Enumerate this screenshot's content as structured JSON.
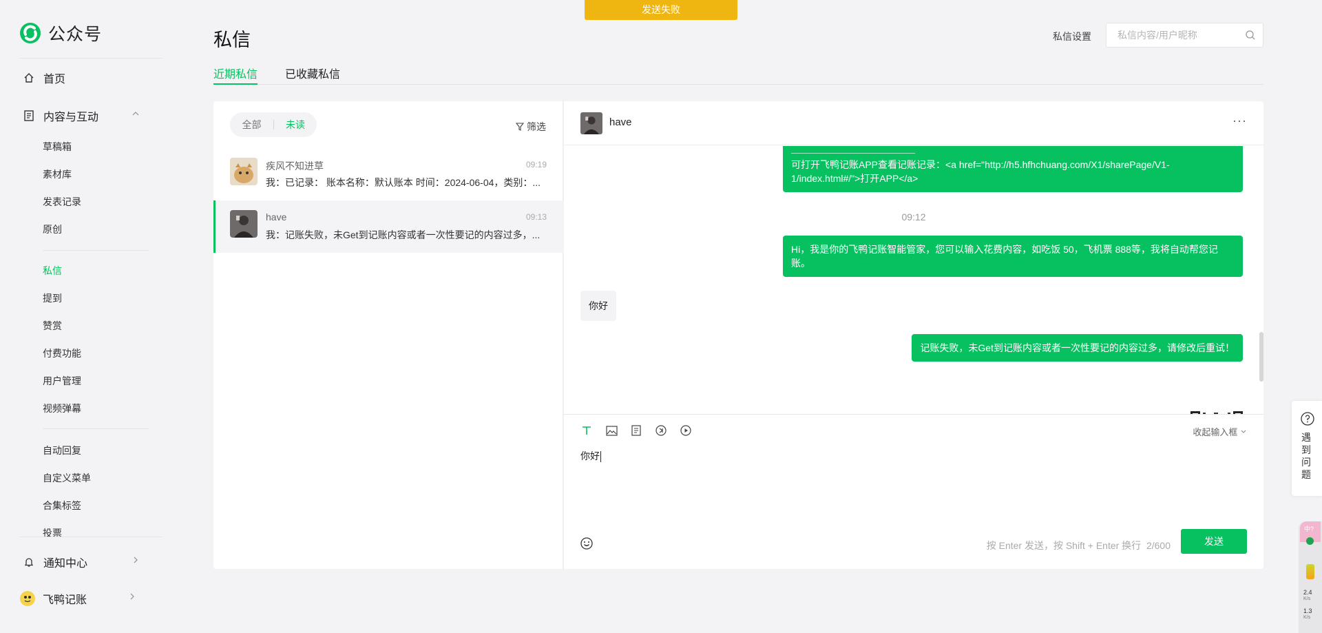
{
  "toast": "发送失败",
  "brand": {
    "name": "公众号",
    "accent": "#07c160",
    "toast_color": "#efb612"
  },
  "sidebar": {
    "home": "首页",
    "content_group": "内容与互动",
    "items": [
      "草稿箱",
      "素材库",
      "发表记录",
      "原创",
      "私信",
      "提到",
      "赞赏",
      "付费功能",
      "用户管理",
      "视频弹幕",
      "自动回复",
      "自定义菜单",
      "合集标签",
      "投票"
    ],
    "active_item": "私信",
    "notifications": "通知中心",
    "account": "飞鸭记账"
  },
  "header": {
    "title": "私信",
    "settings": "私信设置",
    "search_placeholder": "私信内容/用户昵称"
  },
  "tabs": [
    "近期私信",
    "已收藏私信"
  ],
  "list": {
    "filter_all": "全部",
    "filter_unread": "未读",
    "filter_button": "筛选",
    "conversations": [
      {
        "name": "疾风不知进草",
        "time": "09:19",
        "preview": "我：已记录： 账本名称：默认账本 时间：2024-06-04，类别：..."
      },
      {
        "name": "have",
        "time": "09:13",
        "preview": "我：记账失败，未Get到记账内容或者一次性要记的内容过多，..."
      }
    ]
  },
  "chat": {
    "user": "have",
    "more": "···",
    "messages": {
      "m1": "可打开飞鸭记账APP查看记账记录：<a href=\"http://h5.hfhchuang.com/X1/sharePage/V1-1/index.html#/\">打开APP</a>",
      "time": "09:12",
      "m2": "Hi，我是你的飞鸭记账智能管家，您可以输入花费内容，如吃饭 50，飞机票 888等，我将自动帮您记账。",
      "m3": "你好",
      "m4": "记账失败，未Get到记账内容或者一次性要记的内容过多，请修改后重试！"
    },
    "composer": {
      "collapse": "收起输入框",
      "text": "你好",
      "hint": "按 Enter 发送，按 Shift + Enter 换行",
      "count": "2/600",
      "send": "发送"
    }
  },
  "help": {
    "label": "遇到问题"
  },
  "monitor": {
    "up": "2.4",
    "up_unit": "K/s",
    "down": "1.3",
    "down_unit": "K/s",
    "badge": "中?"
  }
}
